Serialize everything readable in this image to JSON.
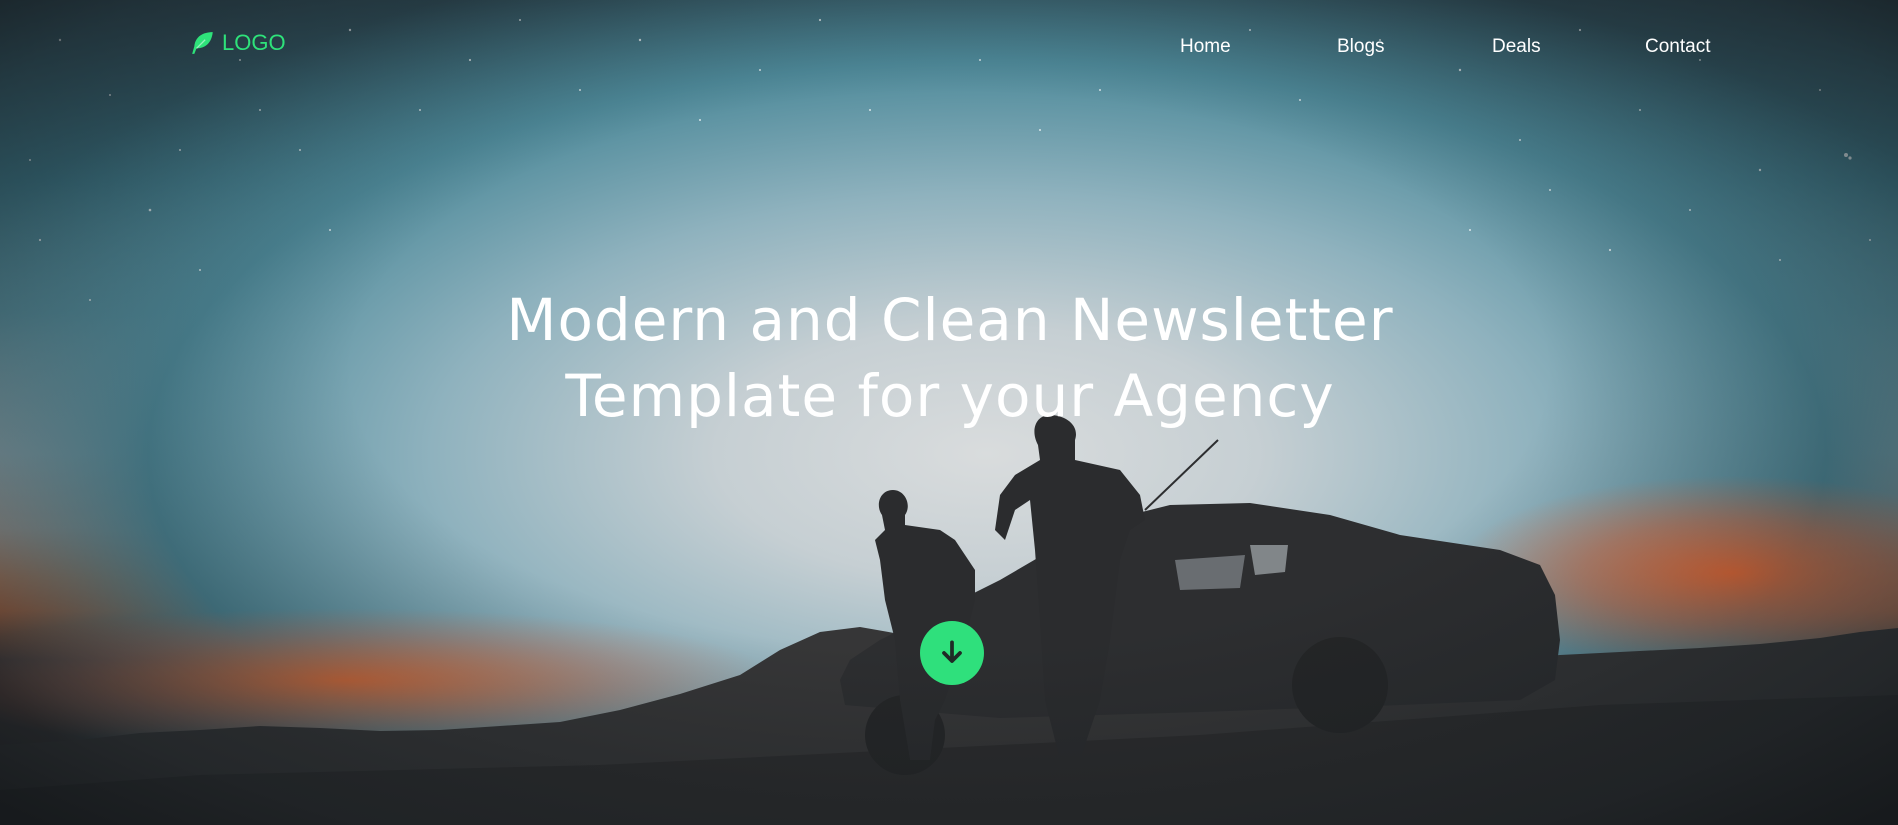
{
  "brand": {
    "logo_text": "LOGO",
    "logo_icon": "leaf-icon",
    "accent_color": "#2ee27a"
  },
  "nav": {
    "items": [
      {
        "label": "Home"
      },
      {
        "label": "Blogs"
      },
      {
        "label": "Deals"
      },
      {
        "label": "Contact"
      }
    ]
  },
  "hero": {
    "title_line_1": "Modern and Clean Newsletter",
    "title_line_2": "Template for your Agency",
    "scroll_icon": "arrow-down-icon"
  }
}
